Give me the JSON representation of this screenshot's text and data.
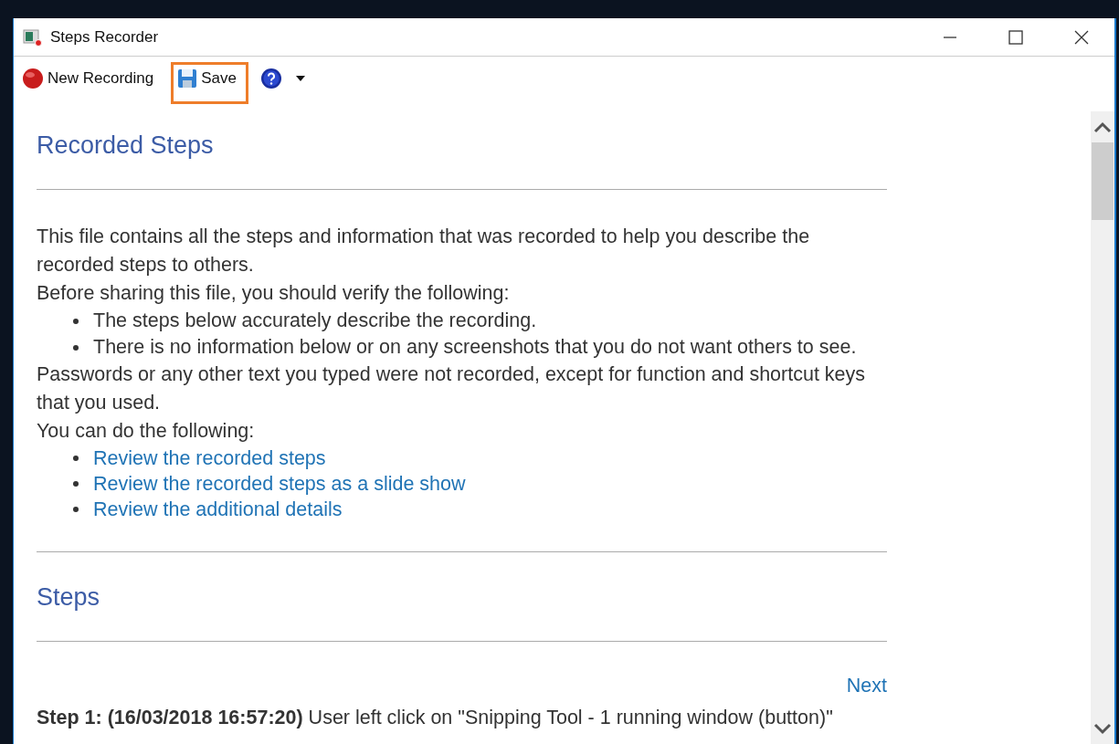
{
  "window": {
    "title": "Steps Recorder"
  },
  "toolbar": [
    {
      "kind": "record",
      "label": "New Recording",
      "highlighted": false
    },
    {
      "kind": "save",
      "label": "Save",
      "highlighted": true
    },
    {
      "kind": "help",
      "highlighted": false
    }
  ],
  "content": {
    "heading": "Recorded Steps",
    "intro": [
      "This file contains all the steps and information that was recorded to help you describe the recorded steps to others.",
      "Before sharing this file, you should verify the following:"
    ],
    "checklist": [
      "The steps below accurately describe the recording.",
      "There is no information below or on any screenshots that you do not want others to see."
    ],
    "notes": [
      "Passwords or any other text you typed were not recorded, except for function and shortcut keys that you used.",
      "You can do the following:"
    ],
    "links": [
      "Review the recorded steps",
      "Review the recorded steps as a slide show",
      "Review the additional details"
    ],
    "steps_heading": "Steps",
    "next_link": "Next",
    "steps": [
      "**Step 1: (16/03/2018 16:57:20)** User left click on \"Snipping Tool - 1 running window (button)\""
    ]
  }
}
